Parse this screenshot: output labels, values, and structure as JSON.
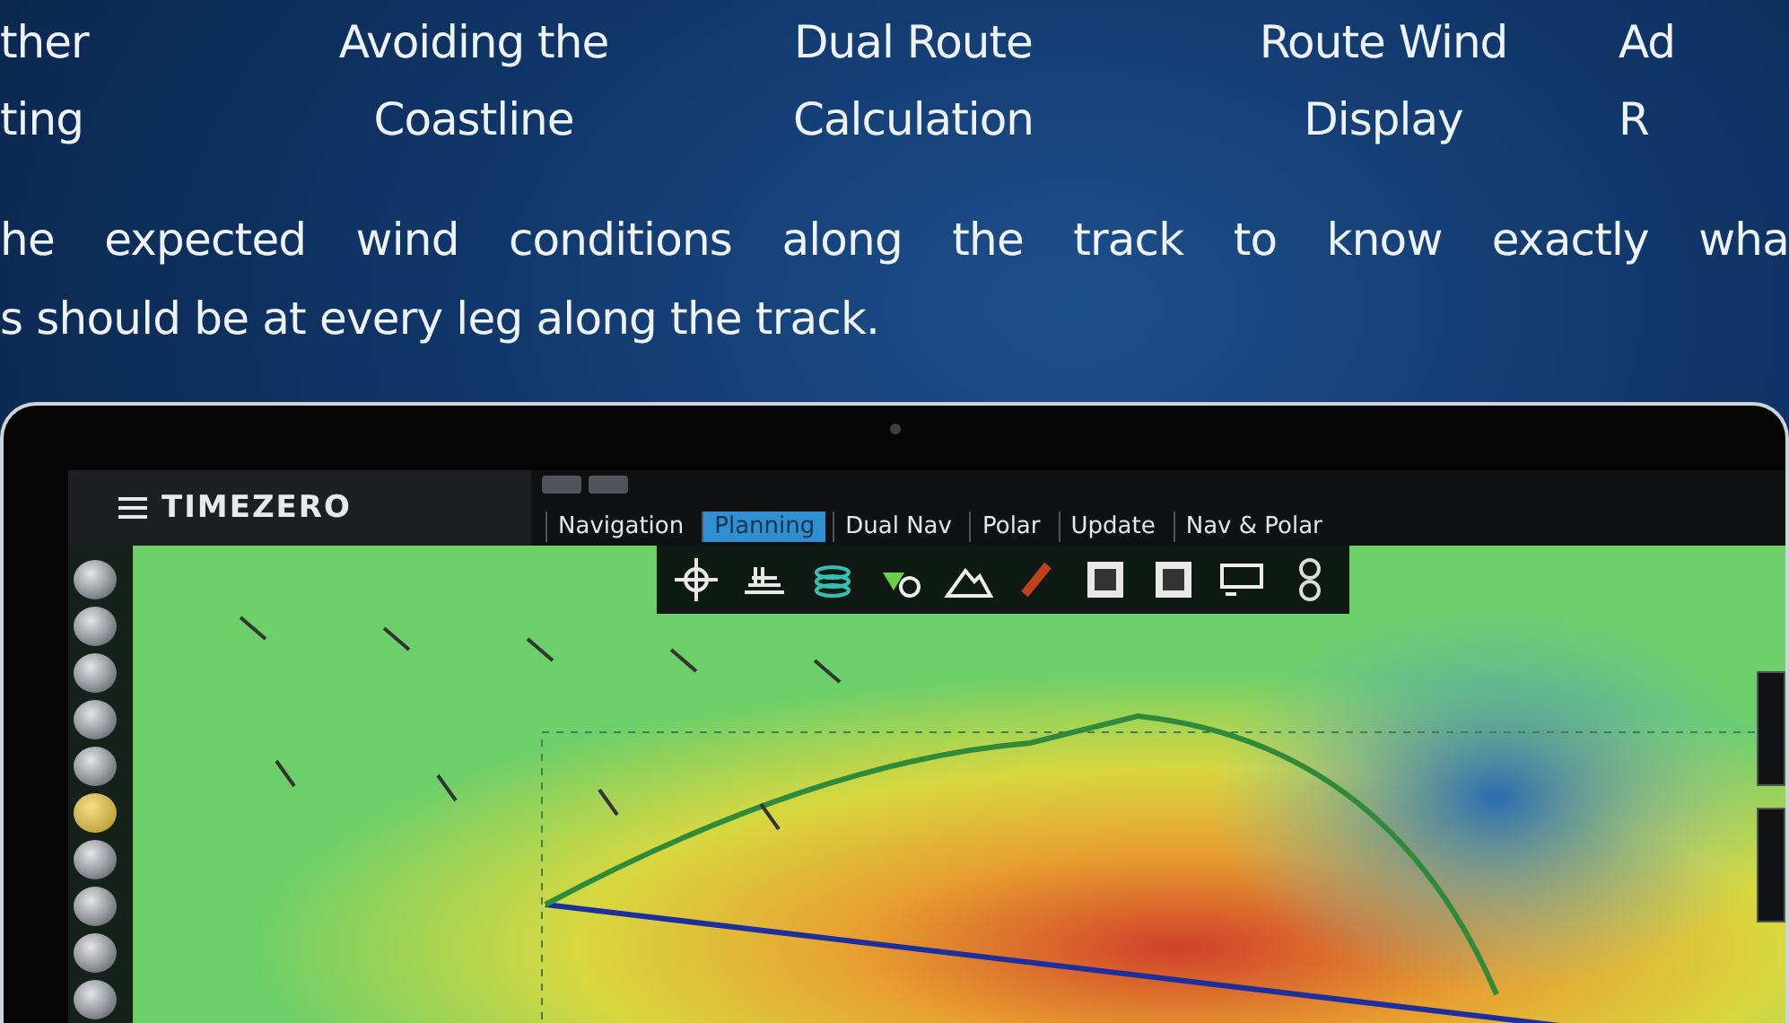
{
  "feature_tabs": [
    {
      "lines": [
        "ther",
        "ting"
      ]
    },
    {
      "lines": [
        "Avoiding the",
        "Coastline"
      ]
    },
    {
      "lines": [
        "Dual Route",
        "Calculation"
      ]
    },
    {
      "lines": [
        "Route Wind",
        "Display"
      ]
    },
    {
      "lines": [
        "Ad",
        "R"
      ]
    }
  ],
  "description": {
    "lines": [
      "he expected wind conditions along the track to know exactly wha",
      "s should be at every leg along the track."
    ]
  },
  "app": {
    "logo": "TIMEZERO",
    "tabs": [
      {
        "label": "Navigation",
        "selected": false
      },
      {
        "label": "Planning",
        "selected": true
      },
      {
        "label": "Dual Nav",
        "selected": false
      },
      {
        "label": "Polar",
        "selected": false
      },
      {
        "label": "Update",
        "selected": false
      },
      {
        "label": "Nav & Polar",
        "selected": false
      }
    ],
    "toolbar_tools": [
      {
        "kind": "compass"
      },
      {
        "kind": "layers"
      },
      {
        "kind": "rings"
      },
      {
        "kind": "pin"
      },
      {
        "kind": "terrain"
      },
      {
        "kind": "pencil"
      },
      {
        "kind": "frame"
      },
      {
        "kind": "frame"
      },
      {
        "kind": "panel"
      },
      {
        "kind": "knob"
      }
    ],
    "side_tools": [
      {
        "selected": false
      },
      {
        "selected": false
      },
      {
        "selected": false
      },
      {
        "selected": false
      },
      {
        "selected": false
      },
      {
        "selected": true
      },
      {
        "selected": false
      },
      {
        "selected": false
      },
      {
        "selected": false
      },
      {
        "selected": false
      }
    ],
    "side_panels": [
      {
        "kind": "tab"
      },
      {
        "kind": "tab"
      }
    ]
  }
}
